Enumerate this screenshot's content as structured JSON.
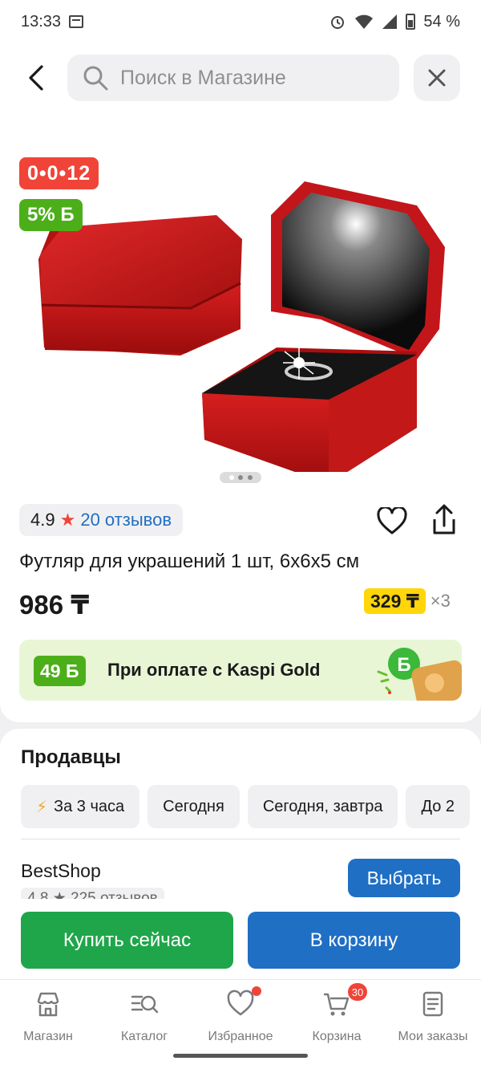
{
  "status_bar": {
    "time": "13:33",
    "battery": "54 %"
  },
  "search": {
    "placeholder": "Поиск в Магазине"
  },
  "product": {
    "timer_badge": "0•0•12",
    "bonus_badge": "5% Б",
    "rating": "4.9",
    "reviews": "20 отзывов",
    "title": "Футляр для украшений 1 шт, 6х6х5 см",
    "price": "986 ₸",
    "installment_amount": "329 ₸",
    "installment_months": "×3"
  },
  "gold_banner": {
    "bonus": "49 Б",
    "text": "При оплате с Kaspi Gold"
  },
  "sellers": {
    "title": "Продавцы",
    "chips": [
      "За 3 часа",
      "Сегодня",
      "Сегодня, завтра",
      "До 2"
    ],
    "seller": {
      "name": "BestShop",
      "rating": "4.8 ★ 225 отзывов",
      "select_label": "Выбрать"
    }
  },
  "actions": {
    "buy_now": "Купить сейчас",
    "to_cart": "В корзину"
  },
  "tab_bar": {
    "items": [
      {
        "label": "Магазин",
        "icon": "shop-icon"
      },
      {
        "label": "Каталог",
        "icon": "catalog-icon"
      },
      {
        "label": "Избранное",
        "icon": "heart-icon"
      },
      {
        "label": "Корзина",
        "icon": "cart-icon",
        "badge": "30"
      },
      {
        "label": "Мои заказы",
        "icon": "orders-icon"
      }
    ]
  },
  "colors": {
    "accent_blue": "#1f6fc5",
    "buy_green": "#1fa64a",
    "bonus_green": "#4caf1a",
    "timer_red": "#f04438",
    "installment_yellow": "#ffd60a"
  }
}
